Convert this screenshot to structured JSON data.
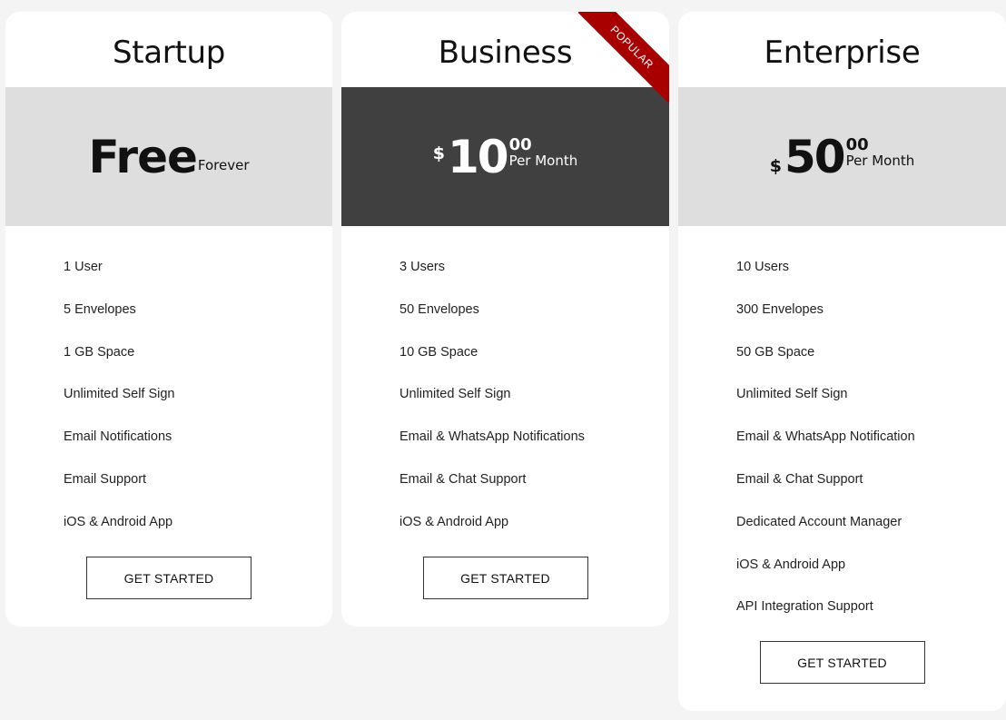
{
  "plans": [
    {
      "title": "Startup",
      "price": {
        "main": "Free",
        "suffix": "Forever"
      },
      "features": [
        "1 User",
        "5 Envelopes",
        "1 GB Space",
        "Unlimited Self Sign",
        "Email Notifications",
        "Email Support",
        "iOS & Android App"
      ],
      "button_label": "GET STARTED"
    },
    {
      "title": "Business",
      "badge": "POPULAR",
      "price": {
        "currency": "$",
        "amount": "10",
        "cents": "00",
        "period": "Per Month"
      },
      "features": [
        "3 Users",
        "50 Envelopes",
        "10 GB Space",
        "Unlimited Self Sign",
        "Email & WhatsApp Notifications",
        "Email & Chat Support",
        "iOS & Android App"
      ],
      "button_label": "GET STARTED"
    },
    {
      "title": "Enterprise",
      "price": {
        "currency": "$",
        "amount": "50",
        "cents": "00",
        "period": "Per Month"
      },
      "features": [
        "10 Users",
        "300 Envelopes",
        "50 GB Space",
        "Unlimited Self Sign",
        "Email & WhatsApp Notification",
        "Email & Chat Support",
        "Dedicated Account Manager",
        "iOS & Android App",
        "API Integration Support"
      ],
      "button_label": "GET STARTED"
    }
  ],
  "colors": {
    "page_bg": "#f4f4f4",
    "price_band_light": "#dedede",
    "price_band_dark": "#404040",
    "ribbon": "#a80000"
  }
}
